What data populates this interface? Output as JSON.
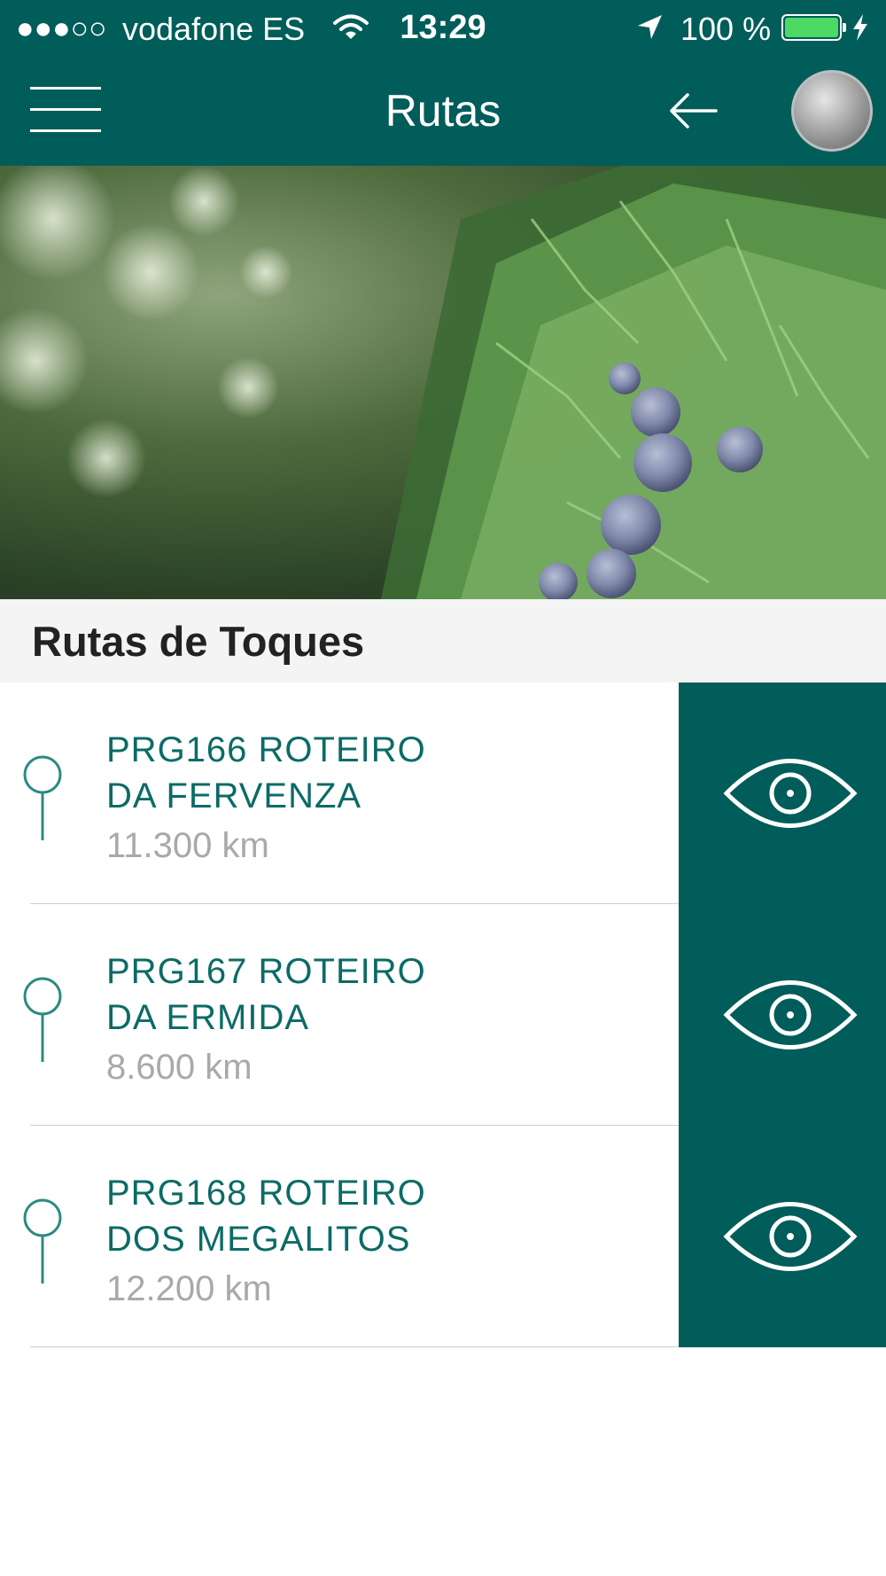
{
  "status_bar": {
    "signal": "●●●○○",
    "carrier": "vodafone ES",
    "time": "13:29",
    "battery": "100 %",
    "battery_color": "#4cd964"
  },
  "header": {
    "title": "Rutas",
    "menu_icon": "hamburger-icon",
    "back_icon": "back-arrow-icon",
    "background_color": "#005d59"
  },
  "section": {
    "title": "Rutas de Toques"
  },
  "routes": [
    {
      "name_line1": "PRG166 ROTEIRO",
      "name_line2": "DA FERVENZA",
      "distance": "11.300 km",
      "action_icon": "eye-icon"
    },
    {
      "name_line1": "PRG167 ROTEIRO",
      "name_line2": "DA ERMIDA",
      "distance": "8.600 km",
      "action_icon": "eye-icon"
    },
    {
      "name_line1": "PRG168 ROTEIRO",
      "name_line2": "DOS MEGALITOS",
      "distance": "12.200 km",
      "action_icon": "eye-icon"
    }
  ],
  "colors": {
    "accent": "#005d59",
    "route_name": "#0b6b66",
    "distance": "#a9a9a9"
  }
}
